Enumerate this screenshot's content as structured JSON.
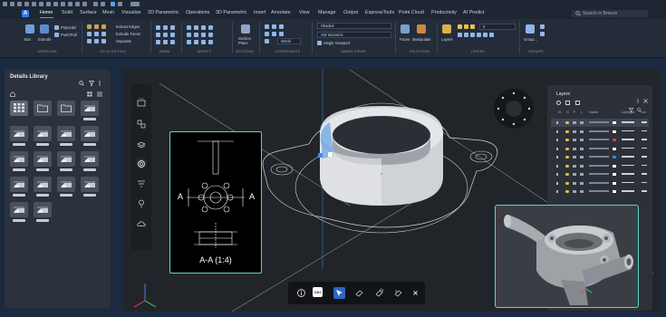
{
  "menu": {
    "app_logo": "A",
    "tabs": [
      "Home",
      "Solid",
      "Surface",
      "Mesh",
      "Visualize",
      "2D Parametric",
      "Operations",
      "3D Parametric",
      "Insert",
      "Annotate",
      "View",
      "Manage",
      "Output",
      "ExpressTools",
      "Point Cloud",
      "Productivity",
      "AI Predict"
    ],
    "active_tab": "Home",
    "search_placeholder": "Search in Breeze"
  },
  "ribbon": {
    "modeling": {
      "box": "Box",
      "extrude": "Extrude",
      "polysolid": "Polysolid",
      "pushpull": "Push/Pull",
      "label": "MODELING"
    },
    "solid_editing": {
      "extract_edges": "Extract Edges",
      "extrude_faces": "Extrude Faces",
      "separate": "Separate",
      "label": "SOLID EDITING"
    },
    "draw": {
      "label": "DRAW"
    },
    "modify": {
      "label": "MODIFY"
    },
    "sections": {
      "section_plane": "Section Plane",
      "label": "SECTIONS"
    },
    "coordinates": {
      "world": "World",
      "label": "COORDINATES"
    },
    "named_views": {
      "visual_style": "Shaded",
      "view": "SW Isometric",
      "viewport": "Single Viewport",
      "label": "NAMED VIEWS"
    },
    "selection": {
      "faces": "Faces",
      "manipulate": "Manipulate",
      "label": "SELECTION"
    },
    "layers": {
      "layers": "Layers",
      "current_layer": "0",
      "label": "LAYERS"
    },
    "groups": {
      "group": "Group...",
      "label": "GROUPS"
    }
  },
  "details_library": {
    "title": "Details Library",
    "thumbnails": 18
  },
  "section_view": {
    "label": "A-A (1:4)",
    "cut_letter": "A"
  },
  "layers_panel": {
    "title": "Layers",
    "columns": [
      "N",
      "O",
      "F",
      "L",
      "Name",
      "Linetype",
      "Lin"
    ],
    "row_colors": [
      "#ffffff",
      "#ffffff",
      "#e23b3b",
      "#ffffff",
      "#2f8be0",
      "#ffffff",
      "#ffffff",
      "#ffffff",
      "#ffffff"
    ]
  },
  "bottom_toolbar": {
    "ctrl_label": "Ctrl"
  },
  "colors": {
    "accent": "#4da3ff",
    "teal_frame": "#5fd5c7",
    "canvas": "#212529"
  }
}
